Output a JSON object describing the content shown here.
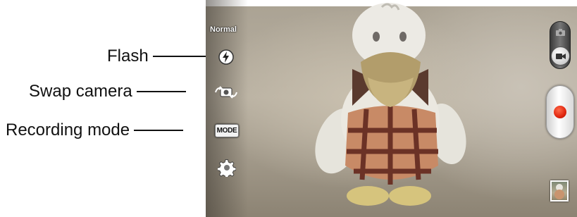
{
  "callouts": {
    "flash": "Flash",
    "swap_camera": "Swap camera",
    "recording_mode": "Recording mode"
  },
  "camera_ui": {
    "scene_mode": "Normal",
    "mode_button_label": "MODE",
    "icons": {
      "flash": "flash-auto-icon",
      "swap": "swap-camera-icon",
      "settings": "gear-icon",
      "switch_top": "camera-icon",
      "switch_knob": "video-camera-icon",
      "record": "record-icon",
      "thumbnail": "gallery-thumbnail"
    },
    "colors": {
      "record_red": "#e0260e",
      "overlay_text": "#ffffff"
    },
    "camera_video_switch": "video"
  }
}
